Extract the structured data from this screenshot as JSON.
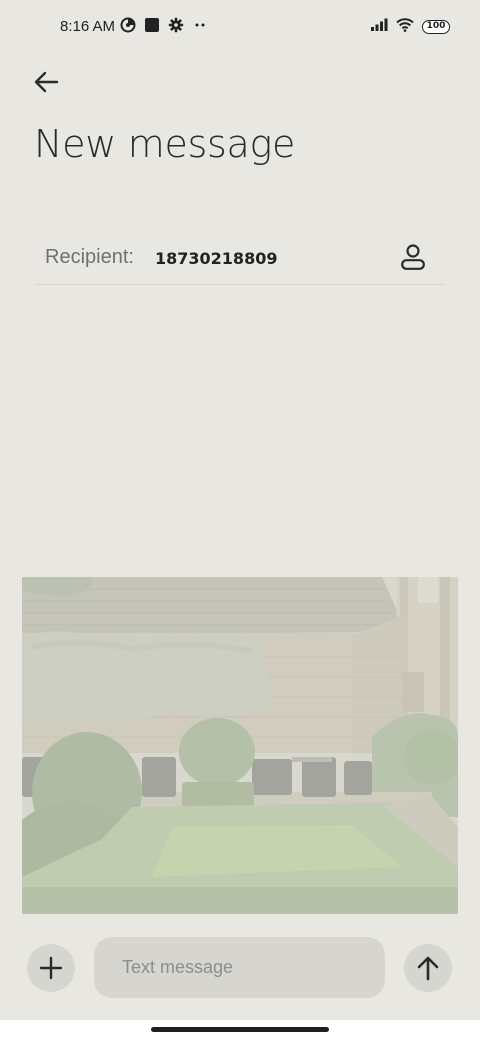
{
  "status_bar": {
    "time": "8:16 AM",
    "battery": "100",
    "left_icons": [
      "data-saver-icon",
      "square-notification-icon",
      "settings-gear-icon",
      "more-dots-icon"
    ],
    "right_icons": [
      "signal-icon",
      "wifi-icon",
      "battery-icon"
    ]
  },
  "header": {
    "back_icon": "arrow-left-icon",
    "title": "New message"
  },
  "recipient": {
    "label": "Recipient:",
    "value": "18730218809",
    "contact_icon": "person-icon"
  },
  "attachment": {
    "type": "image",
    "icon": "garden-photo"
  },
  "composer": {
    "add_icon": "plus-icon",
    "placeholder": "Text message",
    "value": "",
    "send_icon": "arrow-up-icon"
  },
  "colors": {
    "background": "#e8e7e1",
    "button_fill": "#d6d5cf",
    "text_primary": "#2a2a2a",
    "text_secondary": "#707070",
    "divider": "#d6d5cf"
  }
}
